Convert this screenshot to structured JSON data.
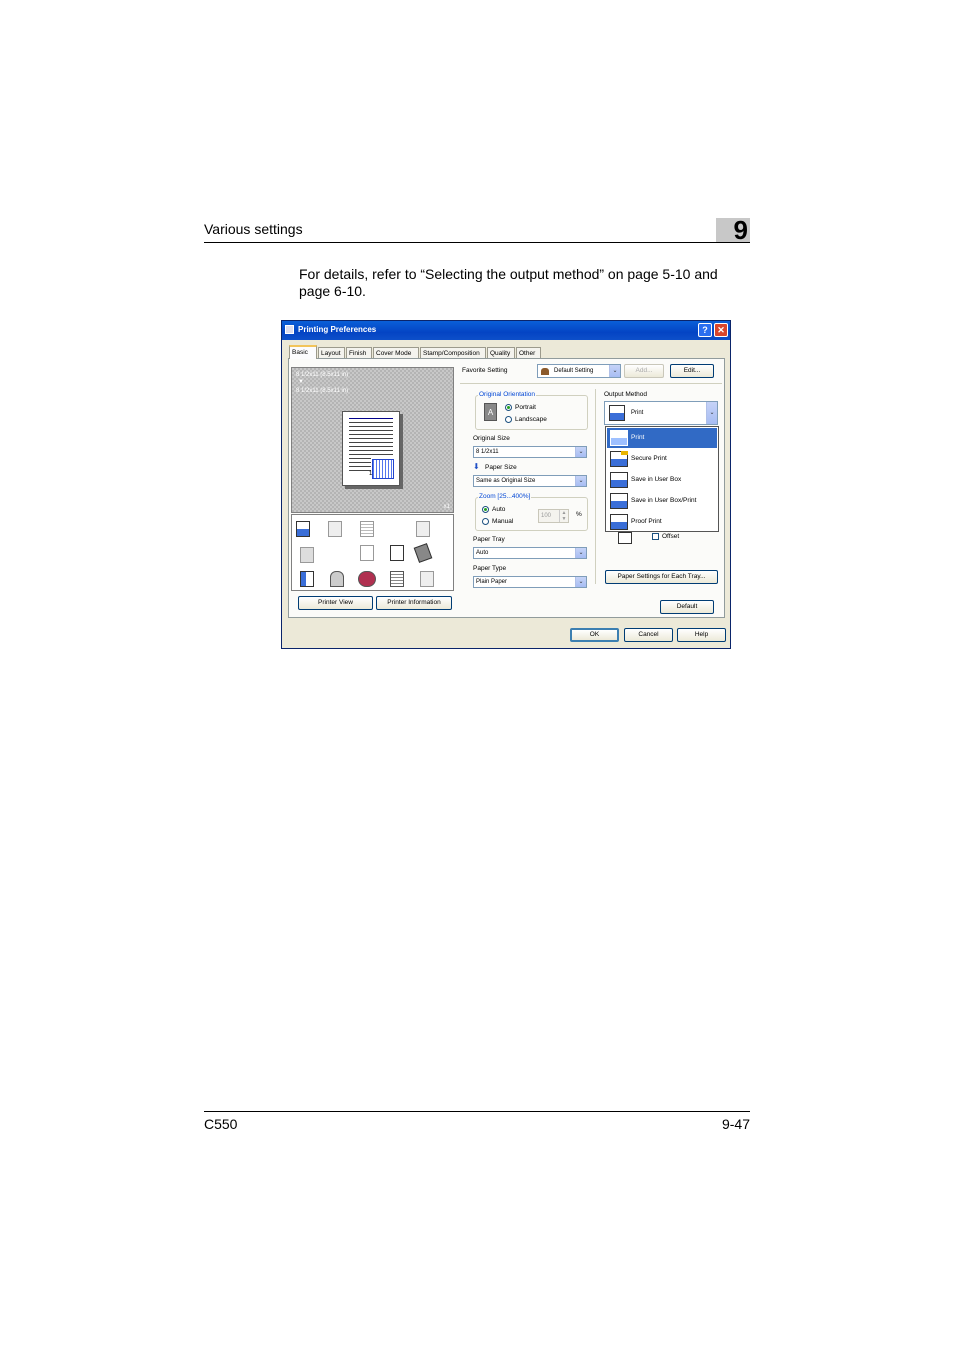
{
  "header": {
    "section_title": "Various settings",
    "chapter_number": "9"
  },
  "body_text": "For details, refer to “Selecting the output method” on page 5-10 and page 6-10.",
  "footer": {
    "model": "C550",
    "page": "9-47"
  },
  "dialog": {
    "title": "Printing Preferences",
    "help_button": "?",
    "close_button": "✕",
    "tabs": [
      "Basic",
      "Layout",
      "Finish",
      "Cover Mode",
      "Stamp/Composition",
      "Quality",
      "Other"
    ],
    "preview": {
      "line1": "8 1/2x11 (8.5x11 in)",
      "arrow": "▼",
      "line2": "8 1/2x11 (8.5x11 in)",
      "page_count": "x1",
      "page_number": "1"
    },
    "printer_view_button": "Printer View",
    "printer_information_button": "Printer Information",
    "favorite": {
      "label": "Favorite Setting",
      "value": "Default Setting",
      "add_button": "Add...",
      "edit_button": "Edit..."
    },
    "original_orientation": {
      "label": "Original Orientation",
      "portrait": "Portrait",
      "landscape": "Landscape",
      "selected": "Portrait",
      "icon_letter": "A"
    },
    "original_size": {
      "label": "Original Size",
      "value": "8 1/2x11"
    },
    "paper_size": {
      "label": "Paper Size",
      "value": "Same as Original Size"
    },
    "zoom": {
      "label": "Zoom [25...400%]",
      "auto": "Auto",
      "manual": "Manual",
      "value": "100",
      "unit": "%"
    },
    "paper_tray": {
      "label": "Paper Tray",
      "value": "Auto"
    },
    "paper_type": {
      "label": "Paper Type",
      "value": "Plain Paper"
    },
    "output_method": {
      "label": "Output Method",
      "value": "Print",
      "options": [
        "Print",
        "Secure Print",
        "Save in User Box",
        "Save in User Box/Print",
        "Proof Print"
      ],
      "selected_index": 0
    },
    "offset_label": "Offset",
    "paper_settings_button": "Paper Settings for Each Tray...",
    "default_button": "Default",
    "ok_button": "OK",
    "cancel_button": "Cancel",
    "help_bottom_button": "Help"
  }
}
